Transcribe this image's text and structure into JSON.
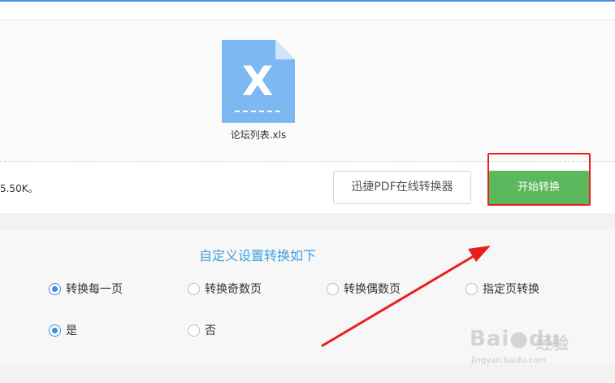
{
  "upload": {
    "file_name": "论坛列表.xls",
    "file_type_letter": "X",
    "size_text": "5.50K。"
  },
  "actions": {
    "secondary_label": "迅捷PDF在线转换器",
    "primary_label": "开始转换"
  },
  "settings": {
    "title": "自定义设置转换如下",
    "page_options": [
      {
        "label": "转换每一页",
        "checked": true
      },
      {
        "label": "转换奇数页",
        "checked": false
      },
      {
        "label": "转换偶数页",
        "checked": false
      },
      {
        "label": "指定页转换",
        "checked": false
      }
    ],
    "yes_no_options": [
      {
        "label": "是",
        "checked": true
      },
      {
        "label": "否",
        "checked": false
      }
    ]
  },
  "watermark": {
    "main": "Bai",
    "paw": "paw-icon",
    "main2": "du",
    "cn": "经验",
    "sub": "jingyan.baidu.com"
  },
  "colors": {
    "accent_blue": "#3ea0e6",
    "primary_green": "#5cb85c",
    "annotation_red": "#e8201c",
    "file_icon_blue": "#7db8f2"
  }
}
